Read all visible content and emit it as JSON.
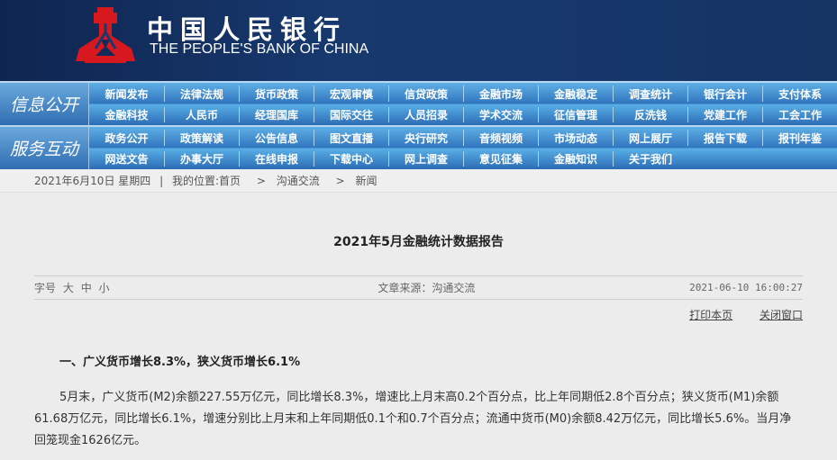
{
  "header": {
    "logo_cn": "中国人民银行",
    "logo_en": "THE PEOPLE'S BANK OF CHINA",
    "brand_red": "#d7181f"
  },
  "nav": [
    {
      "label": "信息公开",
      "items": [
        "新闻发布",
        "法律法规",
        "货币政策",
        "宏观审慎",
        "信贷政策",
        "金融市场",
        "金融稳定",
        "调查统计",
        "银行会计",
        "支付体系",
        "金融科技",
        "人民币",
        "经理国库",
        "国际交往",
        "人员招录",
        "学术交流",
        "征信管理",
        "反洗钱",
        "党建工作",
        "工会工作"
      ]
    },
    {
      "label": "服务互动",
      "items": [
        "政务公开",
        "政策解读",
        "公告信息",
        "图文直播",
        "央行研究",
        "音频视频",
        "市场动态",
        "网上展厅",
        "报告下载",
        "报刊年鉴",
        "网送文告",
        "办事大厅",
        "在线申报",
        "下载中心",
        "网上调查",
        "意见征集",
        "金融知识",
        "关于我们"
      ]
    }
  ],
  "breadcrumb": {
    "date": "2021年6月10日 星期四",
    "sep": "|",
    "prefix": "我的位置:",
    "items": [
      "首页",
      "沟通交流",
      "新闻"
    ],
    "arrow": ">"
  },
  "article": {
    "title": "2021年5月金融统计数据报告",
    "font_label": "字号",
    "font_sizes": [
      "大",
      "中",
      "小"
    ],
    "source": "文章来源：沟通交流",
    "datetime": "2021-06-10 16:00:27",
    "print": "打印本页",
    "close": "关闭窗口",
    "section": "一、广义货币增长8.3%，狭义货币增长6.1%",
    "paragraph": "5月末，广义货币(M2)余额227.55万亿元，同比增长8.3%，增速比上月末高0.2个百分点，比上年同期低2.8个百分点；狭义货币(M1)余额61.68万亿元，同比增长6.1%，增速分别比上月末和上年同期低0.1个和0.7个百分点；流通中货币(M0)余额8.42万亿元，同比增长5.6%。当月净回笼现金1626亿元。"
  }
}
